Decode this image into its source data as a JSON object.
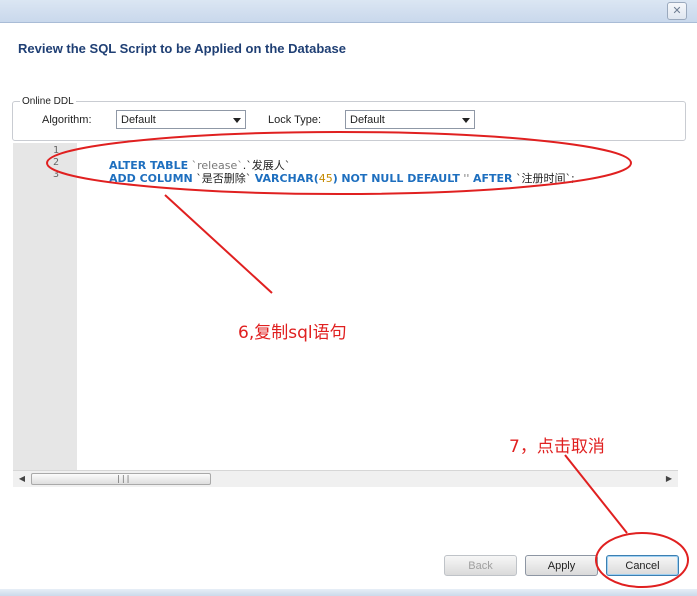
{
  "window": {
    "close_glyph": "✕"
  },
  "header": {
    "title": "Review the SQL Script to be Applied on the Database"
  },
  "online_ddl": {
    "legend": "Online DDL",
    "algorithm_label": "Algorithm:",
    "algorithm_value": "Default",
    "lock_type_label": "Lock Type:",
    "lock_type_value": "Default"
  },
  "editor": {
    "line_numbers": [
      "1",
      "2",
      "3"
    ],
    "line1": {
      "kw1": "ALTER TABLE",
      "t1": "`release`",
      "t2": ".`发展人`"
    },
    "line2": {
      "kw1": "ADD COLUMN",
      "t1": "`是否删除`",
      "kw2": "VARCHAR(",
      "n1": "45",
      "kw3": ")",
      "kw4": "NOT NULL DEFAULT",
      "s1": "''",
      "kw5": "AFTER",
      "t2": "`注册时间`;"
    }
  },
  "scrollbar": {
    "left_arrow": "◀",
    "right_arrow": "▶",
    "grip": "|||"
  },
  "buttons": {
    "back": "Back",
    "apply": "Apply",
    "cancel": "Cancel"
  },
  "annotations": {
    "step6": "6,复制sql语句",
    "step7": "7，点击取消",
    "color": "#e02020"
  }
}
